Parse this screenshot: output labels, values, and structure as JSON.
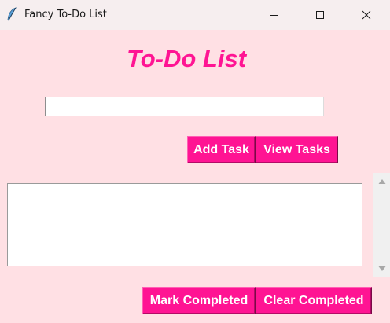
{
  "window": {
    "title": "Fancy To-Do List",
    "icon": "feather-icon",
    "controls": [
      "minimize-icon",
      "maximize-icon",
      "close-icon"
    ]
  },
  "main": {
    "heading": "To-Do List",
    "task_entry": {
      "value": "",
      "placeholder": ""
    },
    "add_task_label": "Add Task",
    "view_tasks_label": "View Tasks",
    "task_list": {
      "items": []
    },
    "mark_completed_label": "Mark Completed",
    "clear_completed_label": "Clear Completed"
  },
  "colors": {
    "background": "#ffe0e4",
    "accent": "#ff1493",
    "button_text": "#ffffff",
    "titlebar": "#f6eeef"
  }
}
